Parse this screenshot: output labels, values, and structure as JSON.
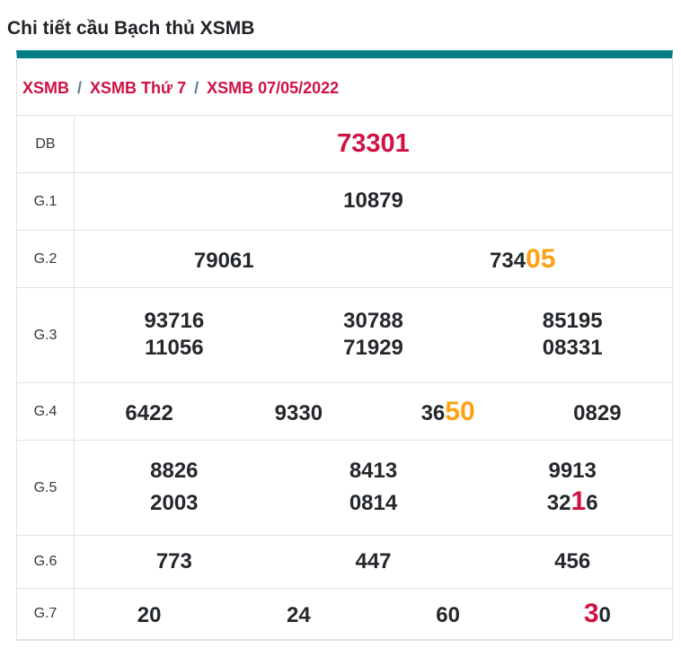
{
  "page_title": "Chi tiết cầu Bạch thủ XSMB",
  "breadcrumb": {
    "separator": "/",
    "items": [
      {
        "label": "XSMB"
      },
      {
        "label": "XSMB Thứ 7"
      },
      {
        "label": "XSMB 07/05/2022"
      }
    ]
  },
  "colors": {
    "accent_teal": "#077d85",
    "link_crimson": "#d01243",
    "highlight_orange": "#fba215",
    "highlight_red": "#d01243",
    "number_dark": "#24282c",
    "border_gray": "#e3e3e3",
    "separator_blue_gray": "#5a7b9e"
  },
  "prize_table": {
    "rows": [
      {
        "label": "DB",
        "lines": [
          [
            {
              "parts": [
                {
                  "t": "73301",
                  "s": "db"
                }
              ]
            }
          ]
        ]
      },
      {
        "label": "G.1",
        "lines": [
          [
            {
              "parts": [
                {
                  "t": "10879",
                  "s": "n"
                }
              ]
            }
          ]
        ]
      },
      {
        "label": "G.2",
        "lines": [
          [
            {
              "parts": [
                {
                  "t": "79061",
                  "s": "n"
                }
              ]
            },
            {
              "parts": [
                {
                  "t": "734",
                  "s": "n"
                },
                {
                  "t": "05",
                  "s": "o"
                }
              ]
            }
          ]
        ]
      },
      {
        "label": "G.3",
        "lines": [
          [
            {
              "parts": [
                {
                  "t": "93716",
                  "s": "n"
                }
              ]
            },
            {
              "parts": [
                {
                  "t": "30788",
                  "s": "n"
                }
              ]
            },
            {
              "parts": [
                {
                  "t": "85195",
                  "s": "n"
                }
              ]
            }
          ],
          [
            {
              "parts": [
                {
                  "t": "11056",
                  "s": "n"
                }
              ]
            },
            {
              "parts": [
                {
                  "t": "71929",
                  "s": "n"
                }
              ]
            },
            {
              "parts": [
                {
                  "t": "08331",
                  "s": "n"
                }
              ]
            }
          ]
        ]
      },
      {
        "label": "G.4",
        "lines": [
          [
            {
              "parts": [
                {
                  "t": "6422",
                  "s": "n"
                }
              ]
            },
            {
              "parts": [
                {
                  "t": "9330",
                  "s": "n"
                }
              ]
            },
            {
              "parts": [
                {
                  "t": "36",
                  "s": "n"
                },
                {
                  "t": "50",
                  "s": "o"
                }
              ]
            },
            {
              "parts": [
                {
                  "t": "0829",
                  "s": "n"
                }
              ]
            }
          ]
        ]
      },
      {
        "label": "G.5",
        "lines": [
          [
            {
              "parts": [
                {
                  "t": "8826",
                  "s": "n"
                }
              ]
            },
            {
              "parts": [
                {
                  "t": "8413",
                  "s": "n"
                }
              ]
            },
            {
              "parts": [
                {
                  "t": "9913",
                  "s": "n"
                }
              ]
            }
          ],
          [
            {
              "parts": [
                {
                  "t": "2003",
                  "s": "n"
                }
              ]
            },
            {
              "parts": [
                {
                  "t": "0814",
                  "s": "n"
                }
              ]
            },
            {
              "parts": [
                {
                  "t": "32",
                  "s": "n"
                },
                {
                  "t": "1",
                  "s": "r"
                },
                {
                  "t": "6",
                  "s": "n"
                }
              ]
            }
          ]
        ]
      },
      {
        "label": "G.6",
        "lines": [
          [
            {
              "parts": [
                {
                  "t": "773",
                  "s": "n"
                }
              ]
            },
            {
              "parts": [
                {
                  "t": "447",
                  "s": "n"
                }
              ]
            },
            {
              "parts": [
                {
                  "t": "456",
                  "s": "n"
                }
              ]
            }
          ]
        ]
      },
      {
        "label": "G.7",
        "lines": [
          [
            {
              "parts": [
                {
                  "t": "20",
                  "s": "n"
                }
              ]
            },
            {
              "parts": [
                {
                  "t": "24",
                  "s": "n"
                }
              ]
            },
            {
              "parts": [
                {
                  "t": "60",
                  "s": "n"
                }
              ]
            },
            {
              "parts": [
                {
                  "t": "3",
                  "s": "r"
                },
                {
                  "t": "0",
                  "s": "n"
                }
              ]
            }
          ]
        ]
      }
    ]
  }
}
